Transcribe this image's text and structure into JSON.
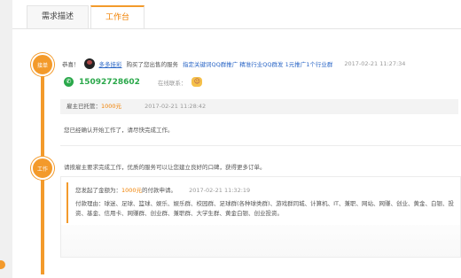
{
  "tabs": [
    "需求描述",
    "工作台"
  ],
  "timeline": {
    "step1": "接单",
    "step2": "工作"
  },
  "order": {
    "greeting": "恭喜！",
    "username": "多多挂彩",
    "bought_text": "购买了您出售的服务",
    "service_name": "指定关键词QQ群推广 精准行业QQ群发 1元推广1个行业群",
    "time": "2017-02-21  11:27:34"
  },
  "contact": {
    "phone": "15092728602",
    "online_label": "在线联系："
  },
  "escrow": {
    "label": "雇主已托管：",
    "amount": "1000元",
    "time": "2017-02-21  11:28:42"
  },
  "confirm_text": "您已经确认开始工作了，请尽快完成工作。",
  "work_tip": "请按雇主要求完成工作，优质的服务可以让您建立良好的口碑，获得更多订单。",
  "payment": {
    "prefix": "您发起了金额为：",
    "amount": "1000元",
    "suffix": "的付款申请。",
    "time": "2017-02-21  11:32:19",
    "reason": "付款理由：球迷、足球、篮球、娱乐、娱乐群、校园群、足球群(各种球类群)、游戏群同城、计算机、IT、兼职、网站、网赚、创业、黄金、白银、投资、基金、信用卡、网赚群、创业群、兼职群、大学生群、黄金白银、创业投资。"
  },
  "icons": {
    "phone": "phone-icon",
    "chat": "chat-icon",
    "avatar": "user-avatar"
  }
}
